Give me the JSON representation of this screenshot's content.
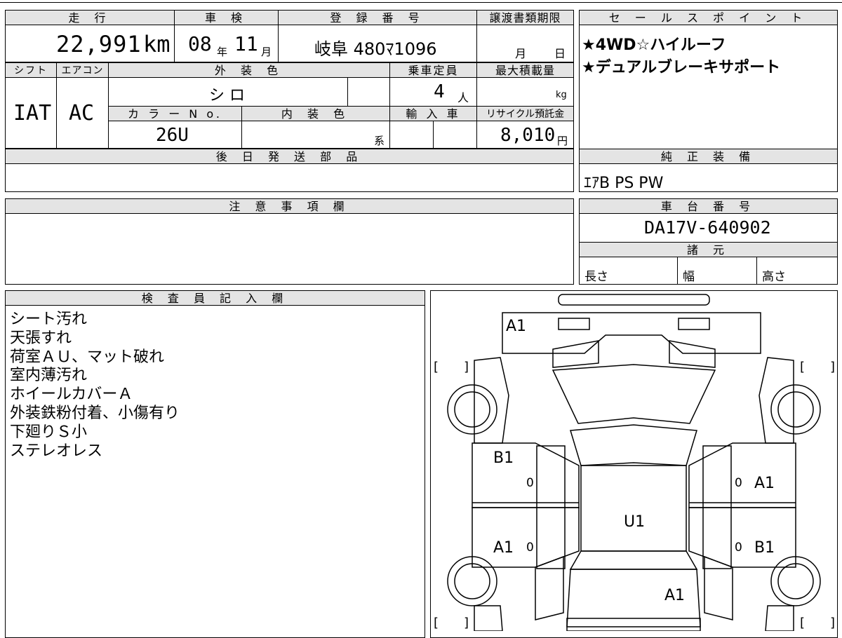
{
  "vehicle": {
    "mileage_header": "走 行",
    "mileage_value": "22,991",
    "mileage_unit": "km",
    "inspection_header": "車 検",
    "inspection_year": "08",
    "inspection_year_unit": "年",
    "inspection_month": "11",
    "inspection_month_unit": "月",
    "registration_header": "登 録 番 号",
    "registration_value": "岐阜 480ﾏ1096",
    "transfer_header": "譲渡書類期限",
    "transfer_month_unit": "月",
    "transfer_day_unit": "日",
    "shift_header": "シフト",
    "shift_value": "IAT",
    "ac_header": "エアコン",
    "ac_value": "AC",
    "exterior_color_header": "外 装 色",
    "exterior_color_value": "シ ロ",
    "capacity_header": "乗車定員",
    "capacity_value": "4",
    "capacity_unit": "人",
    "max_load_header": "最大積載量",
    "max_load_unit": "kg",
    "color_no_header": "カ ラ ー N o.",
    "color_no_value": "26U",
    "interior_color_header": "内 装 色",
    "interior_color_suffix": "系",
    "import_header": "輸 入 車",
    "recycle_header": "リサイクル預託金",
    "recycle_value": "8,010",
    "recycle_unit": "円",
    "later_parts_header": "後 日 発 送 部 品",
    "later_parts_value": ""
  },
  "sales": {
    "header": "セ ー ル ス ポ イ ン ト",
    "lines": [
      "★4WD☆ハイルーフ",
      "★デュアルブレーキサポート"
    ]
  },
  "equipment": {
    "header": "純 正 装 備",
    "value": "ｴｱB PS PW"
  },
  "notes": {
    "header": "注 意 事 項 欄",
    "value": ""
  },
  "chassis": {
    "header": "車 台 番 号",
    "value": "DA17V-640902"
  },
  "specs": {
    "header": "諸 元",
    "length_label": "長さ",
    "width_label": "幅",
    "height_label": "高さ"
  },
  "inspector": {
    "header": "検 査 員 記 入 欄",
    "lines": [
      "シート汚れ",
      "天張すれ",
      "荷室ＡＵ、マット破れ",
      "室内薄汚れ",
      "ホイールカバーＡ",
      "外装鉄粉付着、小傷有り",
      "下廻りＳ小",
      "ステレオレス"
    ]
  },
  "diagram": {
    "marks": {
      "top_a1": "A1",
      "left_front_b1": "B1",
      "left_front_0": "0",
      "right_front_0": "0",
      "right_front_a1": "A1",
      "roof_u1": "U1",
      "left_rear_a1": "A1",
      "left_rear_0": "0",
      "right_rear_0": "0",
      "right_rear_b1": "B1",
      "rear_a1": "A1"
    },
    "bracket_open": "[",
    "bracket_close": "]"
  }
}
